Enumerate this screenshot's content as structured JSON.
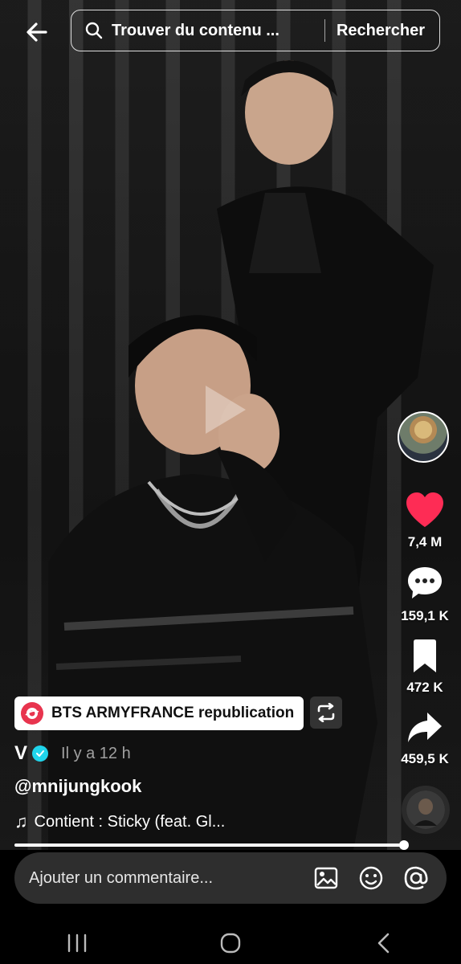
{
  "search": {
    "placeholder": "Trouver du contenu ...",
    "button_label": "Rechercher"
  },
  "side_rail": {
    "likes": "7,4 M",
    "comments": "159,1 K",
    "saves": "472 K",
    "shares": "459,5 K"
  },
  "post": {
    "repost_label": "BTS ARMYFRANCE republication",
    "author": "V",
    "time_ago": "Il y a 12 h",
    "mention": "@mnijungkook",
    "music": "Contient : Sticky (feat. Gl..."
  },
  "playback": {
    "progress_fraction": 0.99
  },
  "comment_bar": {
    "placeholder": "Ajouter un commentaire..."
  },
  "colors": {
    "like": "#fe2c55",
    "verified": "#20d5ec",
    "repost_badge": "#e8344e"
  },
  "icons": [
    "back-arrow-icon",
    "search-icon",
    "heart-icon",
    "comment-icon",
    "bookmark-icon",
    "share-icon",
    "repost-icon",
    "image-icon",
    "emoji-icon",
    "at-icon",
    "recent-apps-icon",
    "home-icon",
    "back-nav-icon"
  ]
}
